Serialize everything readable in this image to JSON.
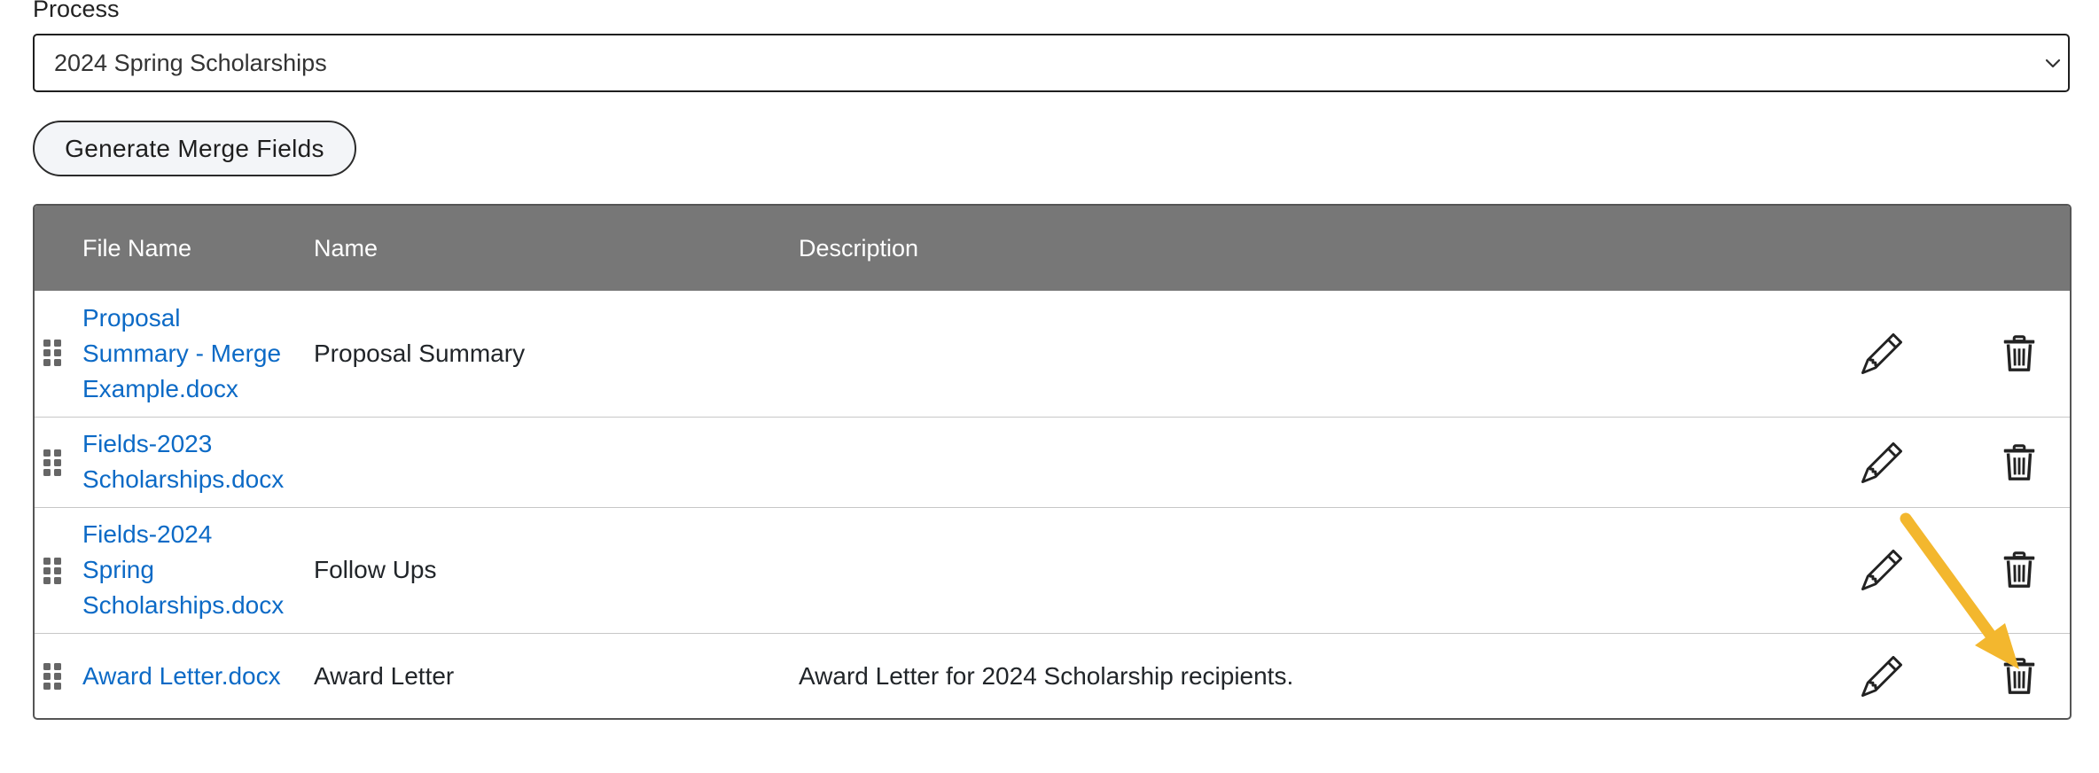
{
  "form": {
    "process_label": "Process",
    "process_value": "2024 Spring Scholarships",
    "generate_button": "Generate Merge Fields"
  },
  "table": {
    "headers": {
      "file_name": "File Name",
      "name": "Name",
      "description": "Description"
    },
    "rows": [
      {
        "file_lines": [
          "Proposal",
          "Summary - Merge",
          "Example.docx"
        ],
        "name": "Proposal Summary",
        "description": ""
      },
      {
        "file_lines": [
          "Fields-2023",
          "Scholarships.docx"
        ],
        "name": "",
        "description": ""
      },
      {
        "file_lines": [
          "Fields-2024",
          "Spring",
          "Scholarships.docx"
        ],
        "name": "Follow Ups",
        "description": ""
      },
      {
        "file_lines": [
          "Award Letter.docx"
        ],
        "name": "Award Letter",
        "description": "Award Letter for 2024 Scholarship recipients."
      }
    ]
  },
  "icons": {
    "drag": "drag-handle-icon",
    "edit": "pencil-icon",
    "delete": "trash-icon",
    "select": "chevron-down-icon"
  },
  "colors": {
    "header_bg": "#777777",
    "link": "#0c6ac6",
    "annotation_arrow": "#f3b72e"
  }
}
